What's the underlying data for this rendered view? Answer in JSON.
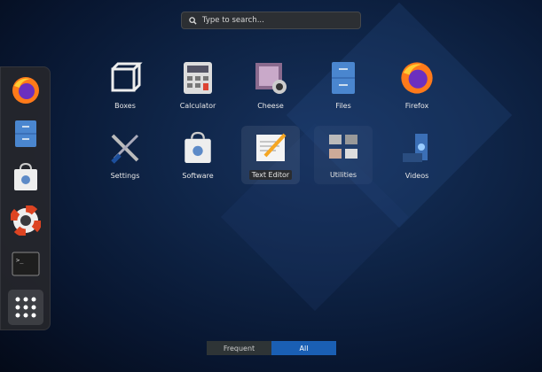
{
  "search": {
    "placeholder": "Type to search..."
  },
  "dock": [
    {
      "name": "Firefox"
    },
    {
      "name": "Files"
    },
    {
      "name": "Software"
    },
    {
      "name": "Help"
    },
    {
      "name": "Terminal"
    },
    {
      "name": "Show Applications"
    }
  ],
  "apps": [
    {
      "label": "Boxes"
    },
    {
      "label": "Calculator"
    },
    {
      "label": "Cheese"
    },
    {
      "label": "Files"
    },
    {
      "label": "Firefox"
    },
    {
      "label": "Settings"
    },
    {
      "label": "Software"
    },
    {
      "label": "Text Editor"
    },
    {
      "label": "Utilities"
    },
    {
      "label": "Videos"
    }
  ],
  "tabs": {
    "frequent": "Frequent",
    "all": "All"
  },
  "colors": {
    "accent": "#1a5fb4",
    "tab_inactive": "#2e3436"
  }
}
